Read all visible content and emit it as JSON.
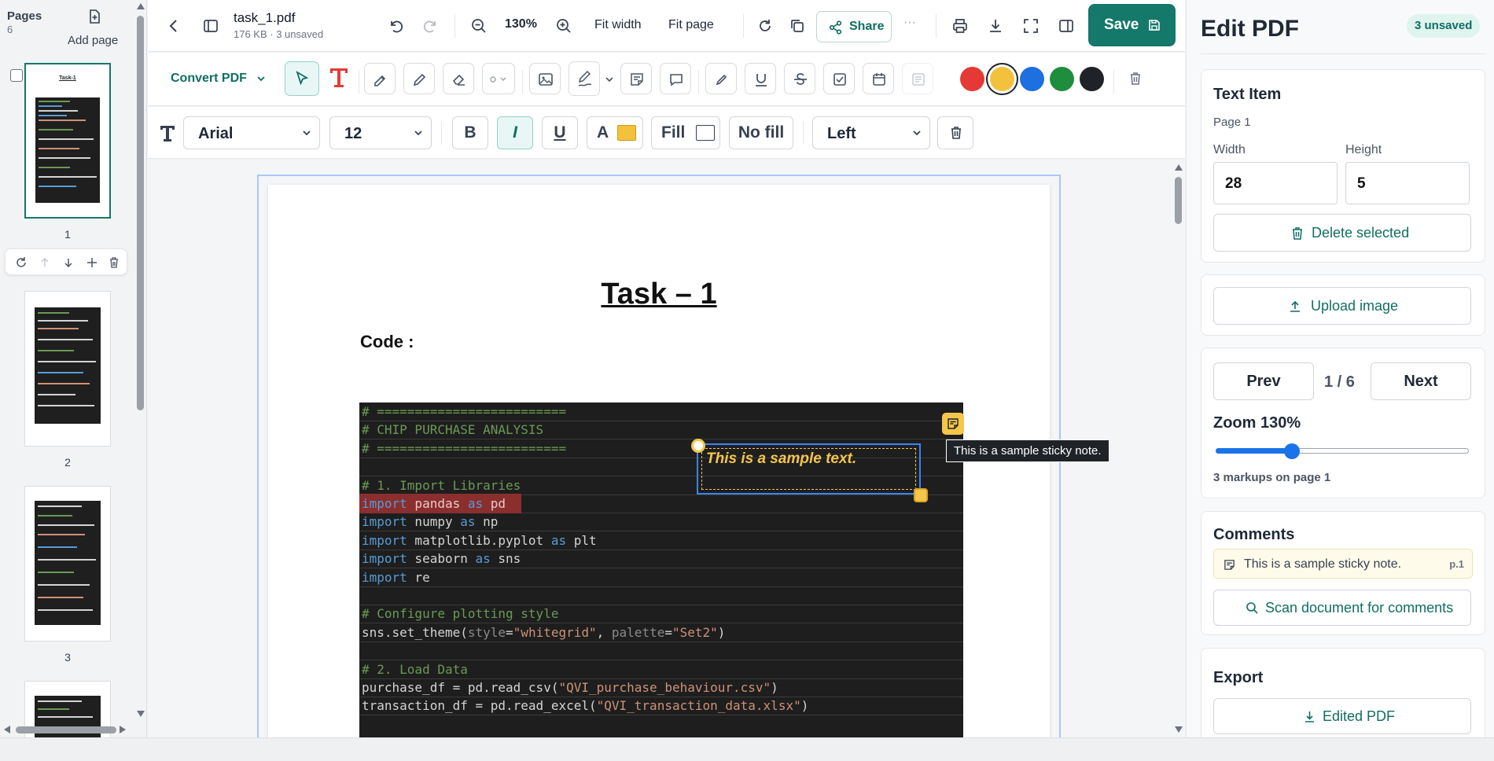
{
  "sidebar": {
    "title": "Pages",
    "count": "6",
    "add_page": "Add page",
    "thumbnails": [
      {
        "num": "1",
        "selected": true
      },
      {
        "num": "2",
        "selected": false
      },
      {
        "num": "3",
        "selected": false
      }
    ],
    "thumb_header": "Task-1"
  },
  "topbar": {
    "file_name": "task_1.pdf",
    "file_meta": "176 KB · 3 unsaved",
    "zoom": "130%",
    "fit_width": "Fit width",
    "fit_page": "Fit page",
    "share": "Share",
    "more": "···",
    "save": "Save"
  },
  "toolbar2": {
    "convert": "Convert PDF",
    "colors": [
      {
        "name": "red",
        "hex": "#e53935"
      },
      {
        "name": "yellow",
        "hex": "#f4c13d",
        "selected": true
      },
      {
        "name": "blue",
        "hex": "#1e6fe0"
      },
      {
        "name": "green",
        "hex": "#1e8e3e"
      },
      {
        "name": "black",
        "hex": "#1f2328"
      }
    ]
  },
  "format": {
    "font": "Arial",
    "size": "12",
    "bold": "B",
    "italic": "I",
    "underline": "U",
    "text_color_label": "A",
    "text_color": "#f4c13d",
    "fill": "Fill",
    "no_fill": "No fill",
    "align": "Left"
  },
  "document": {
    "title": "Task – 1",
    "code_label": "Code :",
    "code_lines": [
      {
        "parts": [
          {
            "t": "# =========================",
            "c": "c-cmt"
          }
        ]
      },
      {
        "parts": [
          {
            "t": "# CHIP PURCHASE ANALYSIS",
            "c": "c-cmt"
          }
        ]
      },
      {
        "parts": [
          {
            "t": "# =========================",
            "c": "c-cmt"
          }
        ]
      },
      {
        "parts": []
      },
      {
        "parts": [
          {
            "t": "# 1. Import Libraries",
            "c": "c-cmt"
          }
        ]
      },
      {
        "highlight": true,
        "parts": [
          {
            "t": "import",
            "c": "c-kw"
          },
          {
            "t": " pandas ",
            "c": ""
          },
          {
            "t": "as",
            "c": "c-kw"
          },
          {
            "t": " pd",
            "c": ""
          }
        ]
      },
      {
        "parts": [
          {
            "t": "import",
            "c": "c-kw"
          },
          {
            "t": " numpy ",
            "c": ""
          },
          {
            "t": "as",
            "c": "c-kw"
          },
          {
            "t": " np",
            "c": ""
          }
        ]
      },
      {
        "parts": [
          {
            "t": "import",
            "c": "c-kw"
          },
          {
            "t": " matplotlib.pyplot ",
            "c": ""
          },
          {
            "t": "as",
            "c": "c-kw"
          },
          {
            "t": " plt",
            "c": ""
          }
        ]
      },
      {
        "parts": [
          {
            "t": "import",
            "c": "c-kw"
          },
          {
            "t": " seaborn ",
            "c": ""
          },
          {
            "t": "as",
            "c": "c-kw"
          },
          {
            "t": " sns",
            "c": ""
          }
        ]
      },
      {
        "parts": [
          {
            "t": "import",
            "c": "c-kw"
          },
          {
            "t": " re",
            "c": ""
          }
        ]
      },
      {
        "parts": []
      },
      {
        "parts": [
          {
            "t": "# Configure plotting style",
            "c": "c-cmt"
          }
        ]
      },
      {
        "parts": [
          {
            "t": "sns.set_theme(",
            "c": ""
          },
          {
            "t": "style",
            "c": "c-arg"
          },
          {
            "t": "=",
            "c": ""
          },
          {
            "t": "\"whitegrid\"",
            "c": "c-str"
          },
          {
            "t": ", ",
            "c": ""
          },
          {
            "t": "palette",
            "c": "c-arg"
          },
          {
            "t": "=",
            "c": ""
          },
          {
            "t": "\"Set2\"",
            "c": "c-str"
          },
          {
            "t": ")",
            "c": ""
          }
        ]
      },
      {
        "parts": []
      },
      {
        "parts": [
          {
            "t": "# 2. Load Data",
            "c": "c-cmt"
          }
        ]
      },
      {
        "parts": [
          {
            "t": "purchase_df = pd.read_csv(",
            "c": ""
          },
          {
            "t": "\"QVI_purchase_behaviour.csv\"",
            "c": "c-str"
          },
          {
            "t": ")",
            "c": ""
          }
        ]
      },
      {
        "parts": [
          {
            "t": "transaction_df = pd.read_excel(",
            "c": ""
          },
          {
            "t": "\"QVI_transaction_data.xlsx\"",
            "c": "c-str"
          },
          {
            "t": ")",
            "c": ""
          }
        ]
      }
    ],
    "sample_text": "This is a sample text.",
    "sticky_tooltip": "This is a sample sticky note."
  },
  "panel": {
    "title": "Edit PDF",
    "unsaved_badge": "3 unsaved",
    "item": {
      "heading": "Text Item",
      "page": "Page 1",
      "width_label": "Width",
      "height_label": "Height",
      "width": "28",
      "height": "5",
      "delete": "Delete selected"
    },
    "upload": "Upload image",
    "nav": {
      "prev": "Prev",
      "indicator": "1 / 6",
      "next": "Next",
      "zoom_label": "Zoom 130%",
      "zoom_fraction": 0.3,
      "markups": "3 markups on page 1"
    },
    "comments": {
      "heading": "Comments",
      "items": [
        {
          "text": "This is a sample sticky note.",
          "page": "p.1"
        }
      ],
      "scan": "Scan document for comments"
    },
    "export": {
      "heading": "Export",
      "button": "Edited PDF"
    }
  }
}
